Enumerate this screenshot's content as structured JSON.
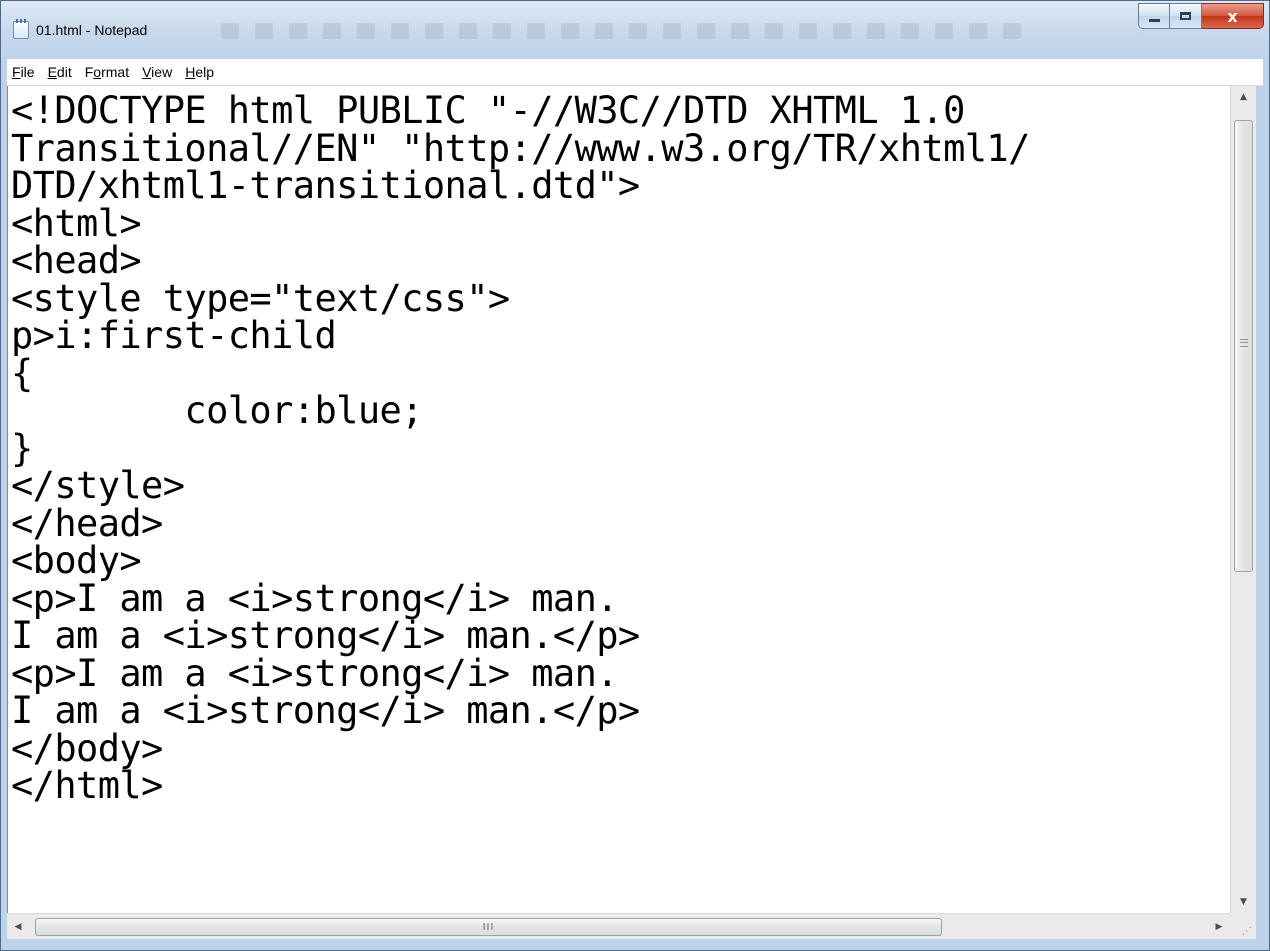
{
  "window": {
    "title": "01.html - Notepad",
    "close_glyph": "x"
  },
  "menu": {
    "file": {
      "key": "F",
      "rest": "ile"
    },
    "edit": {
      "key": "E",
      "rest": "dit"
    },
    "format": {
      "pre": "F",
      "key": "o",
      "rest": "rmat"
    },
    "view": {
      "key": "V",
      "rest": "iew"
    },
    "help": {
      "key": "H",
      "rest": "elp"
    }
  },
  "editor": {
    "content": "<!DOCTYPE html PUBLIC \"-//W3C//DTD XHTML 1.0\nTransitional//EN\" \"http://www.w3.org/TR/xhtml1/\nDTD/xhtml1-transitional.dtd\">\n<html>\n<head>\n<style type=\"text/css\">\np>i:first-child\n{\n        color:blue;\n}\n</style>\n</head>\n<body>\n<p>I am a <i>strong</i> man.\nI am a <i>strong</i> man.</p>\n<p>I am a <i>strong</i> man.\nI am a <i>strong</i> man.</p>\n</body>\n</html>"
  },
  "scrollbars": {
    "up_arrow": "▲",
    "down_arrow": "▼",
    "left_arrow": "◀",
    "right_arrow": "▶",
    "h_thumb_grip": "III"
  },
  "icons": {
    "app": "notepad-icon",
    "minimize": "minimize-icon",
    "maximize": "maximize-icon",
    "close": "close-icon"
  }
}
